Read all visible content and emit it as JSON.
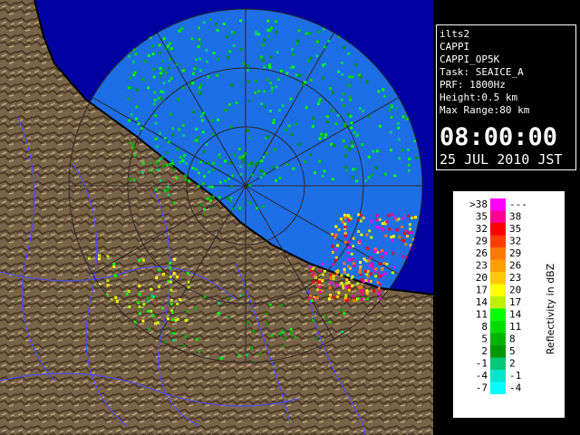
{
  "info": {
    "station": "ilts2",
    "product": "CAPPI",
    "product_id": "CAPPI_OP5K",
    "task": "Task: SEAICE_A",
    "prf": "PRF: 1800Hz",
    "height": "Height:0.5 km",
    "max_range": "Max Range:80 km",
    "time": "08:00:00",
    "date": "25 JUL 2010 JST"
  },
  "legend": {
    "title": "Reflectivity in dBZ",
    "rows": [
      {
        "left": ">38",
        "right": "---",
        "color": "#ff00ff"
      },
      {
        "left": "35",
        "right": "38",
        "color": "#ff0090"
      },
      {
        "left": "32",
        "right": "35",
        "color": "#ff0000"
      },
      {
        "left": "29",
        "right": "32",
        "color": "#ff3c00"
      },
      {
        "left": "26",
        "right": "29",
        "color": "#ff7800"
      },
      {
        "left": "23",
        "right": "26",
        "color": "#ffa000"
      },
      {
        "left": "20",
        "right": "23",
        "color": "#ffc800"
      },
      {
        "left": "17",
        "right": "20",
        "color": "#ffff00"
      },
      {
        "left": "14",
        "right": "17",
        "color": "#bef000"
      },
      {
        "left": "11",
        "right": "14",
        "color": "#00ff00"
      },
      {
        "left": "8",
        "right": "11",
        "color": "#00dc00"
      },
      {
        "left": "5",
        "right": "8",
        "color": "#00b400"
      },
      {
        "left": "2",
        "right": "5",
        "color": "#009600"
      },
      {
        "left": "-1",
        "right": "2",
        "color": "#00c878"
      },
      {
        "left": "-4",
        "right": "-1",
        "color": "#00e6c8"
      },
      {
        "left": "-7",
        "right": "-4",
        "color": "#00ffff"
      }
    ]
  },
  "map": {
    "sea_color": "#1e6ee6",
    "outside_color": "#0000a0",
    "land_color": "#7a644a",
    "coast_color": "#000000",
    "river_color": "#5050e6",
    "range_ring_color": "#2a2a2a"
  }
}
